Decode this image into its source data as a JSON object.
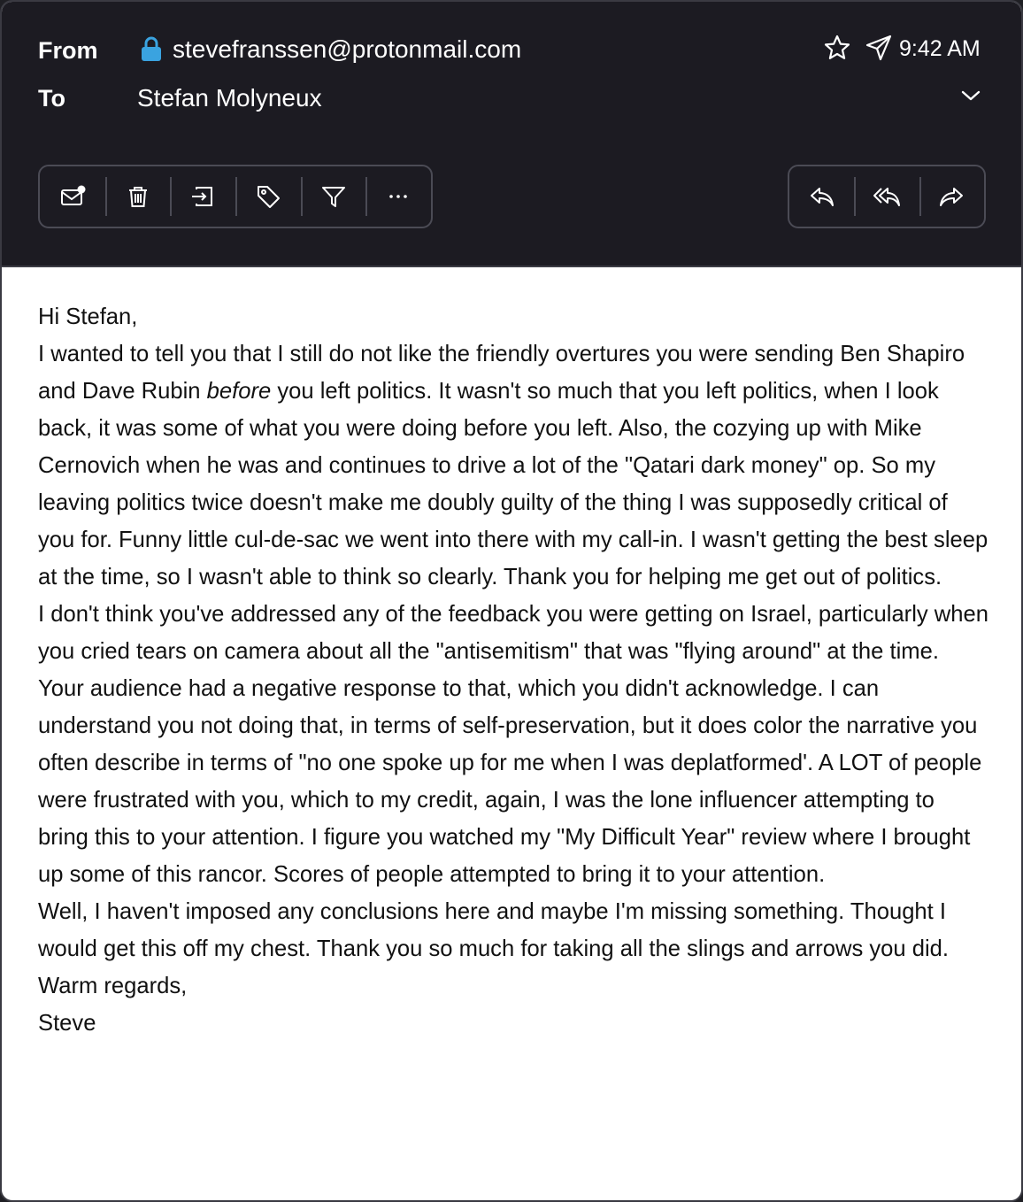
{
  "header": {
    "from_label": "From",
    "from_address": "stevefranssen@protonmail.com",
    "to_label": "To",
    "to_name": "Stefan Molyneux",
    "time": "9:42 AM",
    "icons": [
      "lock-icon",
      "star-icon",
      "send-icon",
      "chevron-down-icon"
    ],
    "lock_color": "#3aa3e0"
  },
  "toolbar": {
    "left_actions": [
      "mark-unread",
      "delete",
      "move",
      "label",
      "filter",
      "more"
    ],
    "right_actions": [
      "reply",
      "reply-all",
      "forward"
    ]
  },
  "message": {
    "greeting": "Hi Stefan,",
    "p1_before_em": "I wanted to tell you that I still do not like the friendly overtures you were sending Ben Shapiro and Dave Rubin ",
    "p1_em": "before",
    "p1_after_em": " you left politics. It wasn't so much that you left politics, when I look back, it was some of what you were doing before you left. Also, the cozying up with Mike Cernovich when he was and continues to drive a lot of the \"Qatari dark money\" op. So my leaving politics twice doesn't make me doubly guilty of the thing I was supposedly critical of you for. Funny little cul-de-sac we went into there with my call-in. I wasn't getting the best sleep at the time, so I wasn't able to think so clearly. Thank you for helping me get out of politics.",
    "p2": "I don't think you've addressed any of the feedback you were getting on Israel, particularly when you cried tears on camera about all the \"antisemitism\" that was \"flying around\" at the time. Your audience had a negative response to that, which you didn't acknowledge. I can understand you not doing that, in terms of self-preservation, but it does color the narrative you often describe in terms of \"no one spoke up for me when I was deplatformed'. A LOT of people were frustrated with you, which to my credit, again, I was the lone influencer attempting to bring this to your attention. I figure you watched my \"My Difficult Year\" review where I brought up some of this rancor. Scores of people attempted to bring it to your attention.",
    "p3": "Well, I haven't imposed any conclusions here and maybe I'm missing something. Thought I would get this off my chest. Thank you so much for taking all the slings and arrows you did.",
    "closing": "Warm regards,",
    "signature": "Steve"
  }
}
